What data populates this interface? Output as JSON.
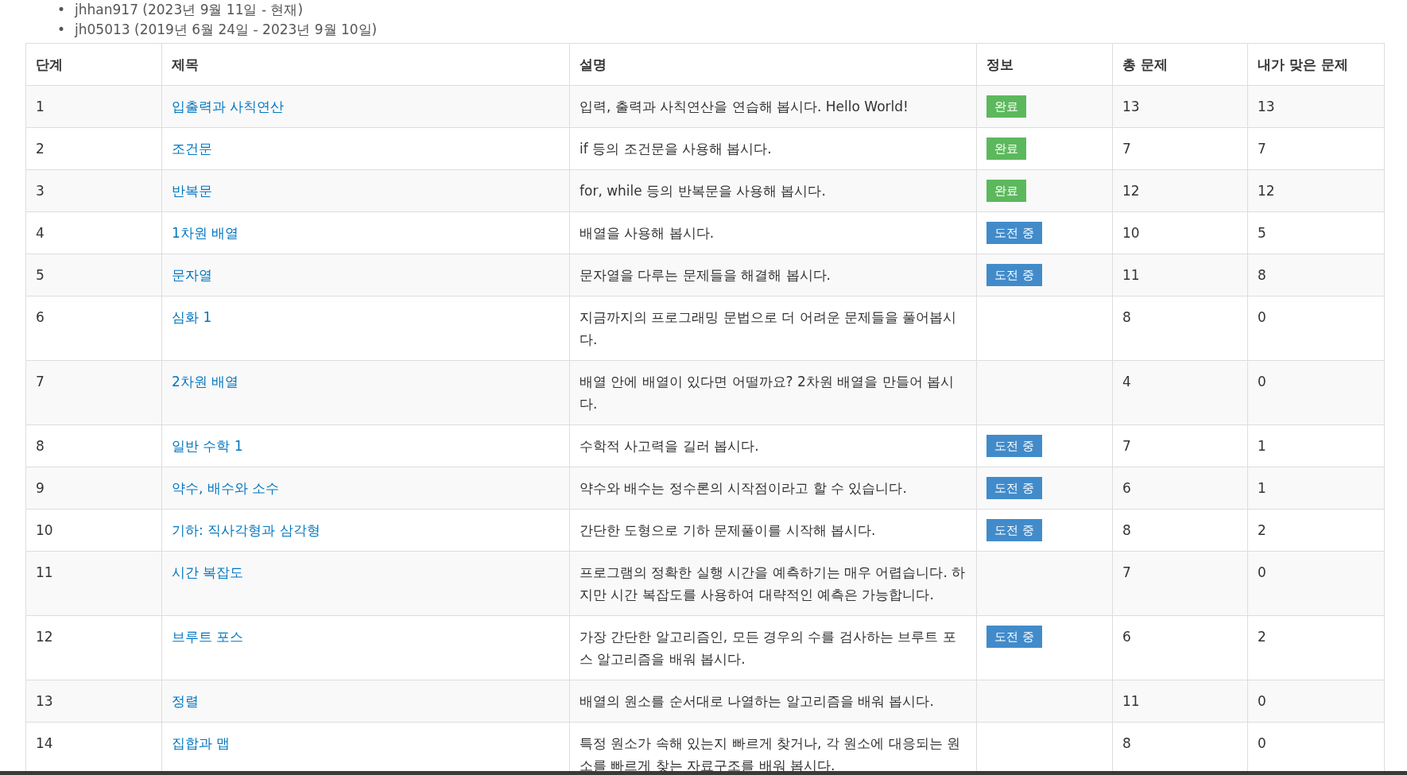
{
  "accounts": [
    {
      "bullet": "•",
      "text": "jhhan917 (2023년 9월 11일 - 현재)"
    },
    {
      "bullet": "•",
      "text": "jh05013 (2019년 6월 24일 - 2023년 9월 10일)"
    }
  ],
  "table": {
    "columns": [
      "단계",
      "제목",
      "설명",
      "정보",
      "총 문제",
      "내가 맞은 문제"
    ],
    "rows": [
      {
        "step": "1",
        "title": "입출력과 사칙연산",
        "description": "입력, 출력과 사칙연산을 연습해 봅시다. Hello World!",
        "badge": {
          "kind": "done",
          "label": "완료"
        },
        "total": "13",
        "solved": "13"
      },
      {
        "step": "2",
        "title": "조건문",
        "description": "if 등의 조건문을 사용해 봅시다.",
        "badge": {
          "kind": "done",
          "label": "완료"
        },
        "total": "7",
        "solved": "7"
      },
      {
        "step": "3",
        "title": "반복문",
        "description": "for, while 등의 반복문을 사용해 봅시다.",
        "badge": {
          "kind": "done",
          "label": "완료"
        },
        "total": "12",
        "solved": "12"
      },
      {
        "step": "4",
        "title": "1차원 배열",
        "description": "배열을 사용해 봅시다.",
        "badge": {
          "kind": "challenge",
          "label": "도전 중"
        },
        "total": "10",
        "solved": "5"
      },
      {
        "step": "5",
        "title": "문자열",
        "description": "문자열을 다루는 문제들을 해결해 봅시다.",
        "badge": {
          "kind": "challenge",
          "label": "도전 중"
        },
        "total": "11",
        "solved": "8"
      },
      {
        "step": "6",
        "title": "심화 1",
        "description": "지금까지의 프로그래밍 문법으로 더 어려운 문제들을 풀어봅시다.",
        "total": "8",
        "solved": "0"
      },
      {
        "step": "7",
        "title": "2차원 배열",
        "description": "배열 안에 배열이 있다면 어떨까요? 2차원 배열을 만들어 봅시다.",
        "total": "4",
        "solved": "0"
      },
      {
        "step": "8",
        "title": "일반 수학 1",
        "description": "수학적 사고력을 길러 봅시다.",
        "badge": {
          "kind": "challenge",
          "label": "도전 중"
        },
        "total": "7",
        "solved": "1"
      },
      {
        "step": "9",
        "title": "약수, 배수와 소수",
        "description": "약수와 배수는 정수론의 시작점이라고 할 수 있습니다.",
        "badge": {
          "kind": "challenge",
          "label": "도전 중"
        },
        "total": "6",
        "solved": "1"
      },
      {
        "step": "10",
        "title": "기하: 직사각형과 삼각형",
        "description": "간단한 도형으로 기하 문제풀이를 시작해 봅시다.",
        "badge": {
          "kind": "challenge",
          "label": "도전 중"
        },
        "total": "8",
        "solved": "2"
      },
      {
        "step": "11",
        "title": "시간 복잡도",
        "description": "프로그램의 정확한 실행 시간을 예측하기는 매우 어렵습니다. 하지만 시간 복잡도를 사용하여 대략적인 예측은 가능합니다.",
        "total": "7",
        "solved": "0"
      },
      {
        "step": "12",
        "title": "브루트 포스",
        "description": "가장 간단한 알고리즘인, 모든 경우의 수를 검사하는 브루트 포스 알고리즘을 배워 봅시다.",
        "badge": {
          "kind": "challenge",
          "label": "도전 중"
        },
        "total": "6",
        "solved": "2"
      },
      {
        "step": "13",
        "title": "정렬",
        "description": "배열의 원소를 순서대로 나열하는 알고리즘을 배워 봅시다.",
        "total": "11",
        "solved": "0"
      },
      {
        "step": "14",
        "title": "집합과 맵",
        "description": "특정 원소가 속해 있는지 빠르게 찾거나, 각 원소에 대응되는 원소를 빠르게 찾는 자료구조를 배워 봅시다.",
        "total": "8",
        "solved": "0"
      }
    ]
  }
}
